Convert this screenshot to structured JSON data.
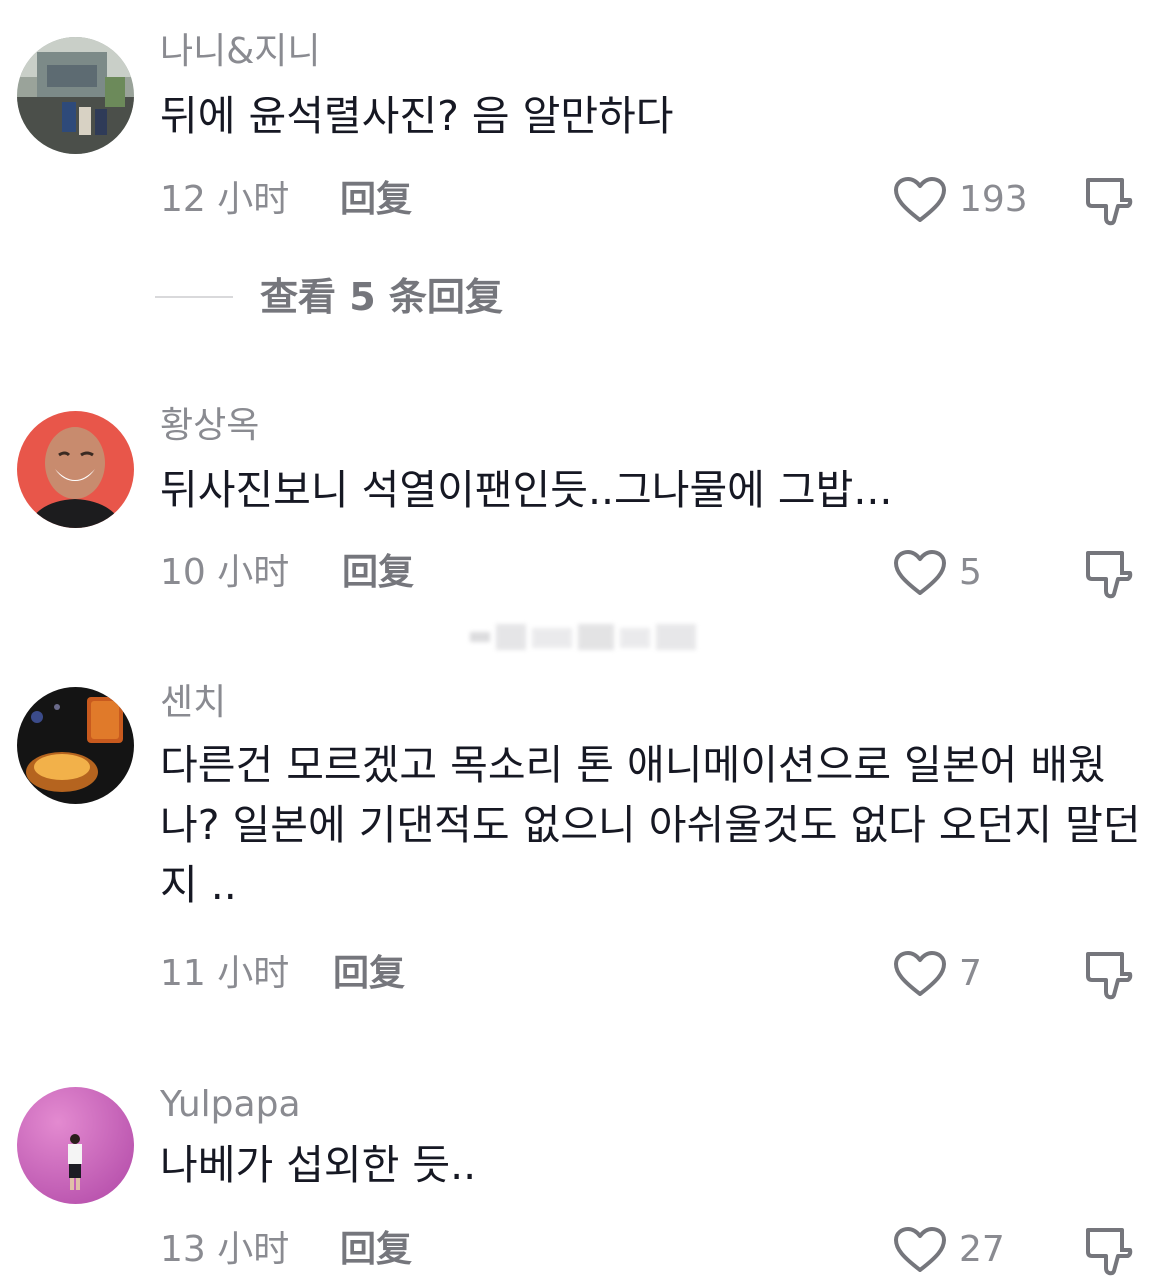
{
  "comments": [
    {
      "username": "나니&지니",
      "text": "뒤에 윤석렬사진? 음 알만하다",
      "time": "12 小时",
      "reply_label": "回复",
      "likes": "193",
      "avatar": "street-photo-avatar"
    },
    {
      "username": "황상옥",
      "text": "뒤사진보니 석열이팬인듯..그나물에 그밥...",
      "time": "10 小时",
      "reply_label": "回复",
      "likes": "5",
      "avatar": "laughing-man-avatar"
    },
    {
      "username": "센치",
      "text": "다른건 모르겠고 목소리 톤 애니메이션으로 일본어 배웠나? 일본에 기댄적도 없으니 아쉬울것도 없다 오던지 말던지 ..",
      "time": "11 小时",
      "reply_label": "回复",
      "likes": "7",
      "avatar": "night-food-avatar"
    },
    {
      "username": "Yulpapa",
      "text": "나베가 섭외한 듯..",
      "time": "13 小时",
      "reply_label": "回复",
      "likes": "27",
      "avatar": "purple-wall-avatar"
    }
  ],
  "view_replies": {
    "label": "查看 5 条回复"
  },
  "icons": {
    "like": "heart-outline-icon",
    "dislike": "thumbs-down-icon"
  },
  "colors": {
    "username": "#8a8b91",
    "body_text": "#161823",
    "meta": "#8a8b91",
    "background": "#ffffff"
  }
}
